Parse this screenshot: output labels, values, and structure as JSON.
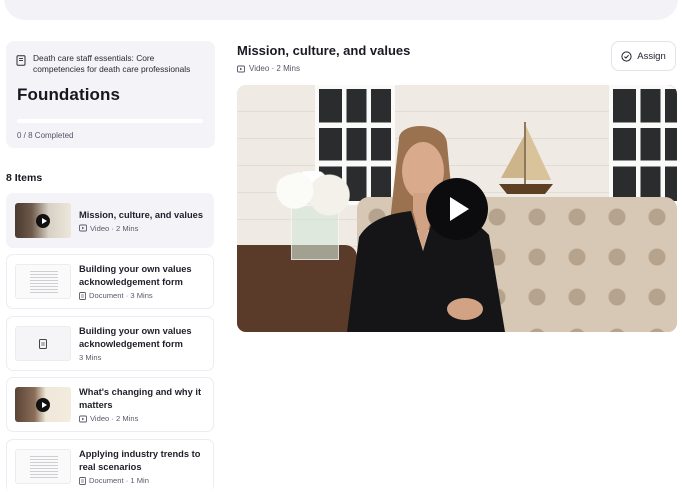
{
  "course": {
    "title": "Death care staff essentials: Core competencies for death care professionals",
    "section": "Foundations",
    "progress_label": "0 / 8 Completed",
    "progress_fraction": 0
  },
  "sidebar": {
    "items_count": "8 Items",
    "items": [
      {
        "title": "Mission, culture, and values",
        "meta": "Video · 2 Mins",
        "kind": "video"
      },
      {
        "title": "Building your own values acknowledgement form",
        "meta": "Document · 3 Mins",
        "kind": "document"
      },
      {
        "title": "Building your own values acknowledgement form",
        "meta": "3 Mins",
        "kind": "none"
      },
      {
        "title": "What's changing and why it matters",
        "meta": "Video · 2 Mins",
        "kind": "video"
      },
      {
        "title": "Applying industry trends to real scenarios",
        "meta": "Document · 1 Min",
        "kind": "document"
      }
    ]
  },
  "content": {
    "title": "Mission, culture, and values",
    "meta": "Video · 2 Mins",
    "assign_label": "Assign"
  },
  "colors": {
    "accent": "#5b5bd6",
    "card_bg": "#f3f3f8",
    "text": "#1f1f2b",
    "muted": "#5a5a6c"
  }
}
